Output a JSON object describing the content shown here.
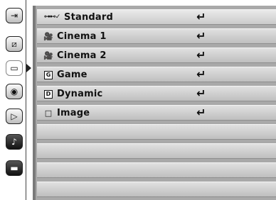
{
  "sidebar": {
    "icons": [
      {
        "name": "input-icon",
        "glyph": "⇥"
      },
      {
        "name": "pc-adjust-icon",
        "glyph": "⧄"
      },
      {
        "name": "image-select-icon",
        "glyph": "▭"
      },
      {
        "name": "image-adjust-icon",
        "glyph": "◉"
      },
      {
        "name": "screen-icon",
        "glyph": "▷"
      },
      {
        "name": "sound-icon",
        "glyph": "♪"
      },
      {
        "name": "setting-icon",
        "glyph": "▬"
      }
    ]
  },
  "menu": {
    "items": [
      {
        "icon": "⊶⊷✓",
        "label": "Standard",
        "enter": "↵"
      },
      {
        "icon": "🎥",
        "label": "Cinema 1",
        "enter": "↵"
      },
      {
        "icon": "🎥",
        "label": "Cinema 2",
        "enter": "↵"
      },
      {
        "icon": "G",
        "label": "Game",
        "enter": "↵"
      },
      {
        "icon": "D",
        "label": "Dynamic",
        "enter": "↵"
      },
      {
        "icon": "□",
        "label": "Image",
        "enter": "↵"
      }
    ]
  }
}
